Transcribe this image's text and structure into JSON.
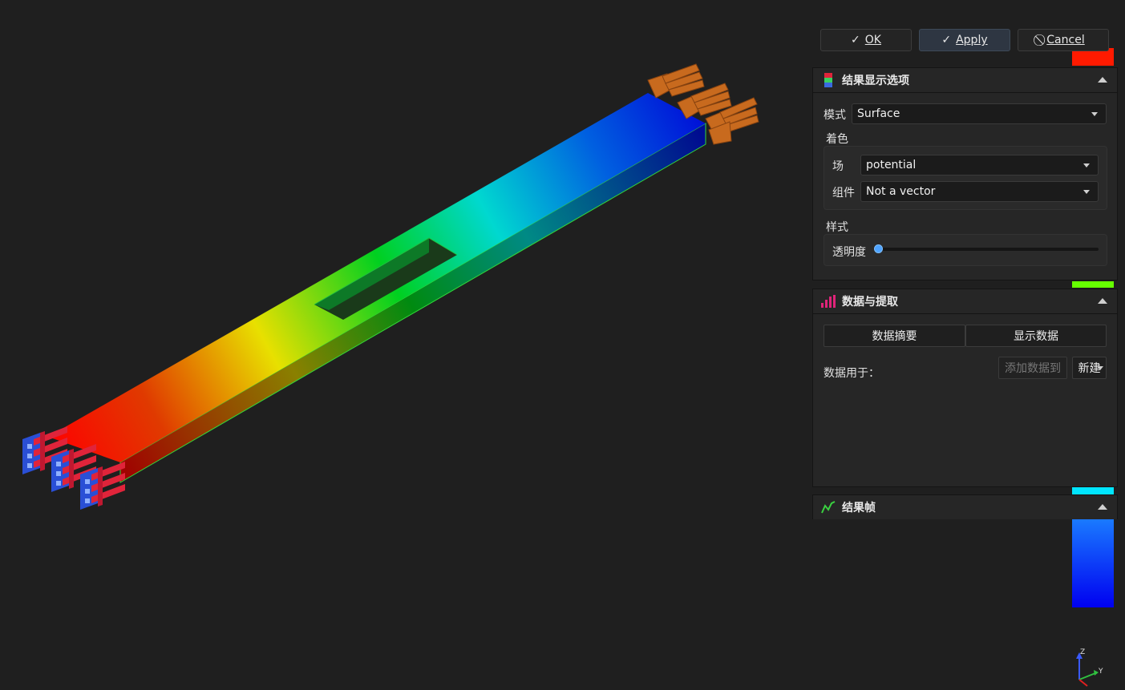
{
  "toolbar": {
    "ok_label": "OK",
    "apply_label": "Apply",
    "cancel_label": "Cancel"
  },
  "result_display": {
    "title": "结果显示选项",
    "mode_label": "模式",
    "mode_value": "Surface",
    "coloring_label": "着色",
    "field_label": "场",
    "field_value": "potential",
    "component_label": "组件",
    "component_value": "Not a vector",
    "style_label": "样式",
    "opacity_label": "透明度",
    "opacity_value": 0
  },
  "data_extract": {
    "title": "数据与提取",
    "summary_button": "数据摘要",
    "show_data_button": "显示数据",
    "data_for_label": "数据用于：",
    "add_data_button": "添加数据到",
    "new_button": "新建"
  },
  "result_frames": {
    "title": "结果帧"
  },
  "axes": {
    "z_label": "Z",
    "y_label": "Y"
  },
  "colors": {
    "panel_bg": "#262626",
    "viewport_bg": "#1f1f1f",
    "accent_blue": "#4ea3ff",
    "colorbar": [
      "#ff1a00",
      "#66ff00",
      "#00e5ff",
      "#0000ff"
    ]
  }
}
